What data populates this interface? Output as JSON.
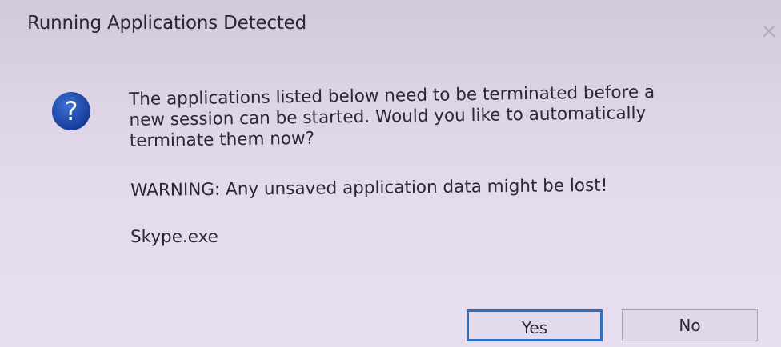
{
  "dialog": {
    "title": "Running Applications Detected",
    "icon": "question-icon",
    "message_lines": [
      "The applications listed below need to be terminated before a",
      "new session can be started. Would you like to automatically",
      "terminate them now?"
    ],
    "warning": "WARNING: Any unsaved application data might be lost!",
    "applications": [
      "Skype.exe"
    ],
    "buttons": {
      "yes": "Yes",
      "no": "No"
    },
    "close_glyph": "×"
  },
  "colors": {
    "default_button_border": "#2f6fc0",
    "icon_blue": "#1a44a8"
  }
}
